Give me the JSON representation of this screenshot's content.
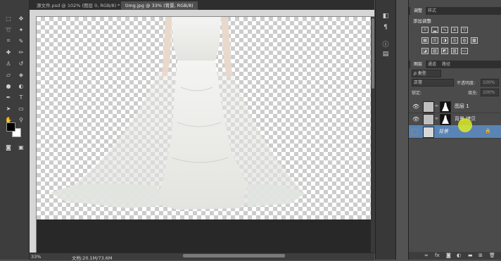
{
  "tabs": [
    {
      "label": "源文件.psd @ 102% (图层 0, RGB/8) *",
      "active": false
    },
    {
      "label": "timg.jpg @ 33% (背景, RGB/8)",
      "active": true
    }
  ],
  "status": {
    "zoom": "33%",
    "doc": "文档:20.1M/73.6M"
  },
  "adjustments": {
    "tabs": [
      "调整",
      "样式"
    ],
    "title": "添加调整"
  },
  "layers_panel": {
    "tabs": [
      "图层",
      "通道",
      "路径"
    ],
    "filter_label": "ρ 类型",
    "blend_mode": "正常",
    "opacity_label": "不透明度:",
    "opacity_value": "100%",
    "lock_label": "锁定:",
    "fill_label": "填充:",
    "fill_value": "100%",
    "layers": [
      {
        "name": "图层 1",
        "visible": true,
        "selected": false
      },
      {
        "name": "背景 拷贝",
        "visible": true,
        "selected": false
      },
      {
        "name": "背景",
        "visible": false,
        "selected": true
      }
    ]
  },
  "colors": {
    "accent_selection": "#5a84b5",
    "cursor_highlight": "#dceb28"
  }
}
